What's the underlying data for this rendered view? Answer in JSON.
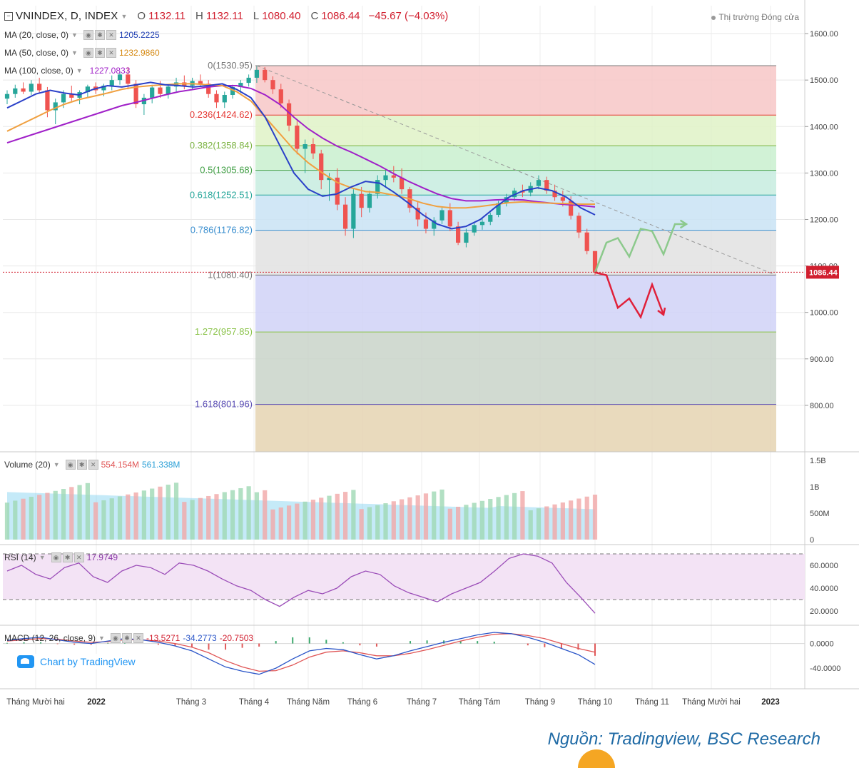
{
  "header": {
    "symbol": "VNINDEX, D, INDEX",
    "open_label": "O",
    "open": "1132.11",
    "high_label": "H",
    "high": "1132.11",
    "low_label": "L",
    "low": "1080.40",
    "close_label": "C",
    "close": "1086.44",
    "change": "−45.67 (−4.03%)",
    "market_status": "Thị trường Đóng cửa"
  },
  "indicators": {
    "ma20": {
      "label": "MA (20, close, 0)",
      "value": "1205.2225",
      "color": "#1f3fb3"
    },
    "ma50": {
      "label": "MA (50, close, 0)",
      "value": "1232.9860",
      "color": "#e8961e"
    },
    "ma100": {
      "label": "MA (100, close, 0)",
      "value": "1227.0833",
      "color": "#a020c8"
    },
    "volume": {
      "label": "Volume (20)",
      "value1": "554.154M",
      "value2": "561.338M"
    },
    "rsi": {
      "label": "RSI (14)",
      "value": "17.9749"
    },
    "macd": {
      "label": "MACD (12, 26, close, 9)",
      "value1": "-13.5271",
      "value2": "-34.2773",
      "value3": "-20.7503"
    }
  },
  "chart_data": {
    "type": "candlestick",
    "price_axis": {
      "min": 700,
      "max": 1660,
      "ticks": [
        800,
        900,
        1000,
        1100,
        1200,
        1300,
        1400,
        1500,
        1600
      ],
      "tick_labels": [
        "800.00",
        "900.00",
        "1000.00",
        "1100.00",
        "1200.00",
        "1300.00",
        "1400.00",
        "1500.00",
        "1600.00"
      ]
    },
    "last_price_label": "1086.44",
    "x_labels": [
      "Tháng Mười hai",
      "2022",
      "Tháng 3",
      "Tháng 4",
      "Tháng Năm",
      "Tháng 6",
      "Tháng 7",
      "Tháng Tám",
      "Tháng 9",
      "Tháng 10",
      "Tháng 11",
      "Tháng Mười hai",
      "2023"
    ],
    "fibonacci": [
      {
        "label": "0(1530.95)",
        "level": 1530.95,
        "line_color": "#787878",
        "fill": "#f7c7c7",
        "text_color": "#777777"
      },
      {
        "label": "0.236(1424.62)",
        "level": 1424.62,
        "line_color": "#e53935",
        "fill": "#dff2c7",
        "text_color": "#e53935"
      },
      {
        "label": "0.382(1358.84)",
        "level": 1358.84,
        "line_color": "#7cb342",
        "fill": "#c9f0cf",
        "text_color": "#7cb342"
      },
      {
        "label": "0.5(1305.68)",
        "level": 1305.68,
        "line_color": "#43a047",
        "fill": "#c7ecdf",
        "text_color": "#43a047"
      },
      {
        "label": "0.618(1252.51)",
        "level": 1252.51,
        "line_color": "#26a69a",
        "fill": "#c9e3f5",
        "text_color": "#26a69a"
      },
      {
        "label": "0.786(1176.82)",
        "level": 1176.82,
        "line_color": "#3b8fcf",
        "fill": "#e2e2e2",
        "text_color": "#3b8fcf"
      },
      {
        "label": "1(1080.40)",
        "level": 1080.4,
        "line_color": "#787878",
        "fill": "#d0d2f7",
        "text_color": "#777777"
      },
      {
        "label": "1.272(957.85)",
        "level": 957.85,
        "line_color": "#8bc34a",
        "fill": "#c9d3c9",
        "text_color": "#8bc34a"
      },
      {
        "label": "1.618(801.96)",
        "level": 801.96,
        "line_color": "#5c4fb5",
        "fill": "#e5d4b2",
        "text_color": "#5c4fb5"
      }
    ],
    "candles": [
      [
        1460,
        1478,
        1448,
        1470
      ],
      [
        1470,
        1490,
        1462,
        1482
      ],
      [
        1482,
        1495,
        1470,
        1475
      ],
      [
        1475,
        1500,
        1468,
        1492
      ],
      [
        1492,
        1505,
        1472,
        1478
      ],
      [
        1478,
        1485,
        1420,
        1435
      ],
      [
        1435,
        1460,
        1405,
        1452
      ],
      [
        1452,
        1478,
        1440,
        1470
      ],
      [
        1470,
        1488,
        1455,
        1462
      ],
      [
        1462,
        1478,
        1448,
        1474
      ],
      [
        1474,
        1490,
        1462,
        1486
      ],
      [
        1486,
        1495,
        1470,
        1478
      ],
      [
        1478,
        1492,
        1465,
        1488
      ],
      [
        1488,
        1510,
        1478,
        1500
      ],
      [
        1500,
        1520,
        1490,
        1512
      ],
      [
        1512,
        1528,
        1480,
        1492
      ],
      [
        1492,
        1500,
        1440,
        1448
      ],
      [
        1448,
        1470,
        1425,
        1462
      ],
      [
        1462,
        1490,
        1450,
        1484
      ],
      [
        1484,
        1498,
        1462,
        1470
      ],
      [
        1470,
        1490,
        1460,
        1486
      ],
      [
        1486,
        1505,
        1475,
        1495
      ],
      [
        1495,
        1510,
        1480,
        1488
      ],
      [
        1488,
        1505,
        1478,
        1498
      ],
      [
        1498,
        1512,
        1485,
        1492
      ],
      [
        1492,
        1500,
        1462,
        1470
      ],
      [
        1470,
        1478,
        1440,
        1452
      ],
      [
        1452,
        1475,
        1440,
        1468
      ],
      [
        1468,
        1490,
        1460,
        1485
      ],
      [
        1485,
        1500,
        1472,
        1494
      ],
      [
        1494,
        1512,
        1486,
        1505
      ],
      [
        1505,
        1530,
        1494,
        1522
      ],
      [
        1522,
        1528,
        1495,
        1500
      ],
      [
        1500,
        1508,
        1470,
        1480
      ],
      [
        1480,
        1492,
        1440,
        1450
      ],
      [
        1450,
        1458,
        1390,
        1402
      ],
      [
        1402,
        1412,
        1340,
        1352
      ],
      [
        1352,
        1372,
        1300,
        1362
      ],
      [
        1362,
        1375,
        1330,
        1342
      ],
      [
        1342,
        1350,
        1265,
        1285
      ],
      [
        1285,
        1300,
        1240,
        1290
      ],
      [
        1290,
        1310,
        1220,
        1232
      ],
      [
        1232,
        1248,
        1165,
        1180
      ],
      [
        1180,
        1265,
        1160,
        1255
      ],
      [
        1255,
        1270,
        1205,
        1225
      ],
      [
        1225,
        1262,
        1215,
        1255
      ],
      [
        1255,
        1295,
        1245,
        1285
      ],
      [
        1285,
        1305,
        1270,
        1295
      ],
      [
        1295,
        1315,
        1280,
        1290
      ],
      [
        1290,
        1310,
        1255,
        1265
      ],
      [
        1265,
        1270,
        1215,
        1225
      ],
      [
        1225,
        1240,
        1185,
        1200
      ],
      [
        1200,
        1215,
        1170,
        1180
      ],
      [
        1180,
        1205,
        1165,
        1198
      ],
      [
        1198,
        1225,
        1190,
        1220
      ],
      [
        1220,
        1235,
        1175,
        1185
      ],
      [
        1185,
        1195,
        1145,
        1150
      ],
      [
        1150,
        1180,
        1140,
        1172
      ],
      [
        1172,
        1195,
        1165,
        1188
      ],
      [
        1188,
        1205,
        1178,
        1195
      ],
      [
        1195,
        1215,
        1188,
        1210
      ],
      [
        1210,
        1240,
        1205,
        1235
      ],
      [
        1235,
        1255,
        1228,
        1248
      ],
      [
        1248,
        1268,
        1240,
        1262
      ],
      [
        1262,
        1275,
        1248,
        1258
      ],
      [
        1258,
        1280,
        1250,
        1272
      ],
      [
        1272,
        1295,
        1265,
        1285
      ],
      [
        1285,
        1292,
        1255,
        1262
      ],
      [
        1262,
        1275,
        1240,
        1248
      ],
      [
        1248,
        1262,
        1228,
        1240
      ],
      [
        1240,
        1250,
        1200,
        1208
      ],
      [
        1208,
        1215,
        1160,
        1172
      ],
      [
        1172,
        1180,
        1125,
        1132
      ],
      [
        1132,
        1132,
        1080,
        1086
      ]
    ],
    "ma20": [
      1440,
      1455,
      1470,
      1478,
      1472,
      1468,
      1480,
      1488,
      1485,
      1490,
      1495,
      1490,
      1488,
      1485,
      1488,
      1492,
      1480,
      1462,
      1420,
      1360,
      1300,
      1265,
      1250,
      1255,
      1270,
      1282,
      1278,
      1258,
      1235,
      1210,
      1190,
      1180,
      1185,
      1200,
      1225,
      1248,
      1262,
      1268,
      1262,
      1248,
      1225,
      1210
    ],
    "ma50": [
      1390,
      1405,
      1420,
      1435,
      1448,
      1458,
      1465,
      1472,
      1480,
      1485,
      1488,
      1490,
      1492,
      1492,
      1490,
      1488,
      1475,
      1455,
      1420,
      1385,
      1350,
      1322,
      1300,
      1280,
      1268,
      1260,
      1258,
      1252,
      1245,
      1235,
      1228,
      1225,
      1225,
      1228,
      1232,
      1236,
      1238,
      1236,
      1235,
      1234,
      1233,
      1233
    ],
    "ma100": [
      1365,
      1375,
      1385,
      1395,
      1405,
      1415,
      1425,
      1435,
      1445,
      1452,
      1460,
      1468,
      1475,
      1480,
      1485,
      1488,
      1488,
      1482,
      1468,
      1448,
      1420,
      1395,
      1375,
      1358,
      1345,
      1330,
      1315,
      1298,
      1282,
      1268,
      1255,
      1245,
      1240,
      1240,
      1242,
      1243,
      1242,
      1238,
      1235,
      1232,
      1230,
      1227
    ],
    "scenario_up": [
      [
        1086,
        1130
      ],
      [
        1150,
        1160
      ],
      [
        1120,
        1180
      ],
      [
        1175,
        1125
      ],
      [
        1190,
        1190
      ]
    ],
    "scenario_down": [
      [
        1086,
        1050
      ],
      [
        1080,
        1010
      ],
      [
        1030,
        990
      ],
      [
        1060,
        995
      ]
    ],
    "volume": {
      "axis_labels": [
        "1.5B",
        "1B",
        "500M",
        "0"
      ],
      "max": 1500
    },
    "rsi": {
      "axis_labels": [
        "60.0000",
        "40.0000",
        "20.0000"
      ],
      "upper": 70,
      "lower": 30,
      "last": 17.9749
    },
    "macd": {
      "axis_labels": [
        "0.0000",
        "-40.0000"
      ],
      "macd_last": -34.2773,
      "signal_last": -13.5271,
      "hist_last": -20.7503
    }
  },
  "branding": {
    "tv_text": "Chart by TradingView"
  },
  "source": "Nguồn: Tradingview, BSC Research"
}
